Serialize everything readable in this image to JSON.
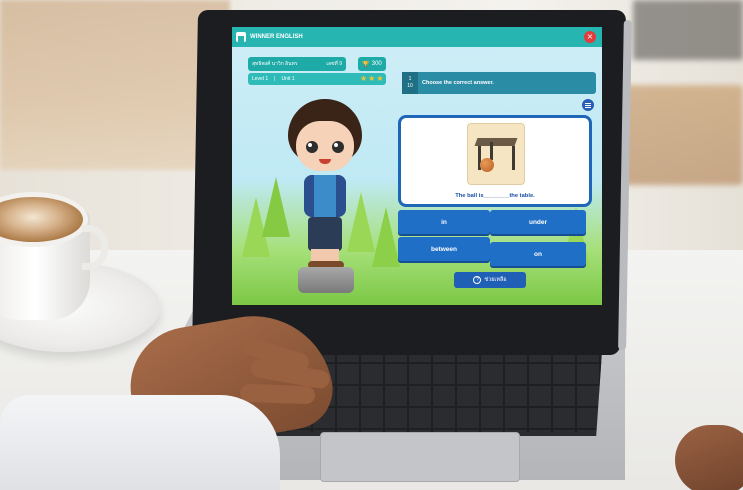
{
  "app": {
    "title": "WINNER ENGLISH",
    "close_label": "×"
  },
  "student": {
    "name": "สุทธิพงศ์ นาวิก อินทร",
    "rank": "เลขที่ 9",
    "points": "300",
    "level": "Level 1",
    "unit": "Unit 1",
    "stars_filled": 3
  },
  "question": {
    "number": "1",
    "total": "10",
    "instruction": "Choose the correct answer.",
    "sentence": "The ball is________the table."
  },
  "answers": [
    "in",
    "under",
    "between",
    "on"
  ],
  "help_label": "ช่วยเหลือ",
  "colors": {
    "accent": "#27b5b2",
    "answer_button": "#1f6fc7",
    "star": "#f7c22a"
  }
}
